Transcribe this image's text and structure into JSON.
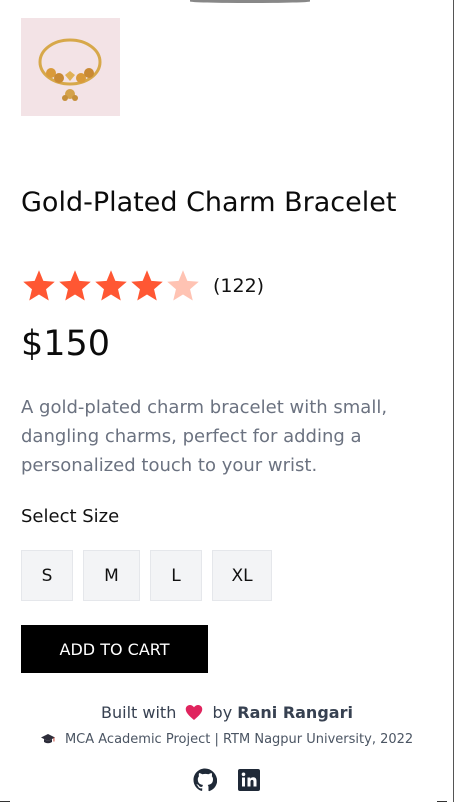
{
  "product": {
    "title": "Gold-Plated Charm Bracelet",
    "rating": 4,
    "rating_max": 5,
    "rating_count": "(122)",
    "price": "$150",
    "description": "A gold-plated charm bracelet with small, dangling charms, perfect for adding a personalized touch to your wrist.",
    "image_icon": "bracelet-image"
  },
  "size": {
    "label": "Select Size",
    "options": [
      "S",
      "M",
      "L",
      "XL"
    ]
  },
  "cart": {
    "add_label": "ADD TO CART"
  },
  "footer": {
    "built_prefix": "Built with",
    "built_by": "by",
    "author": "Rani Rangari",
    "academic": "MCA Academic Project | RTM Nagpur University, 2022",
    "icons": [
      "graduation-cap-icon",
      "github-icon",
      "linkedin-icon"
    ]
  },
  "colors": {
    "star_filled": "#ff5733",
    "star_empty": "#ffc3b3",
    "button_bg": "#000000",
    "heart": "#e0245e"
  }
}
